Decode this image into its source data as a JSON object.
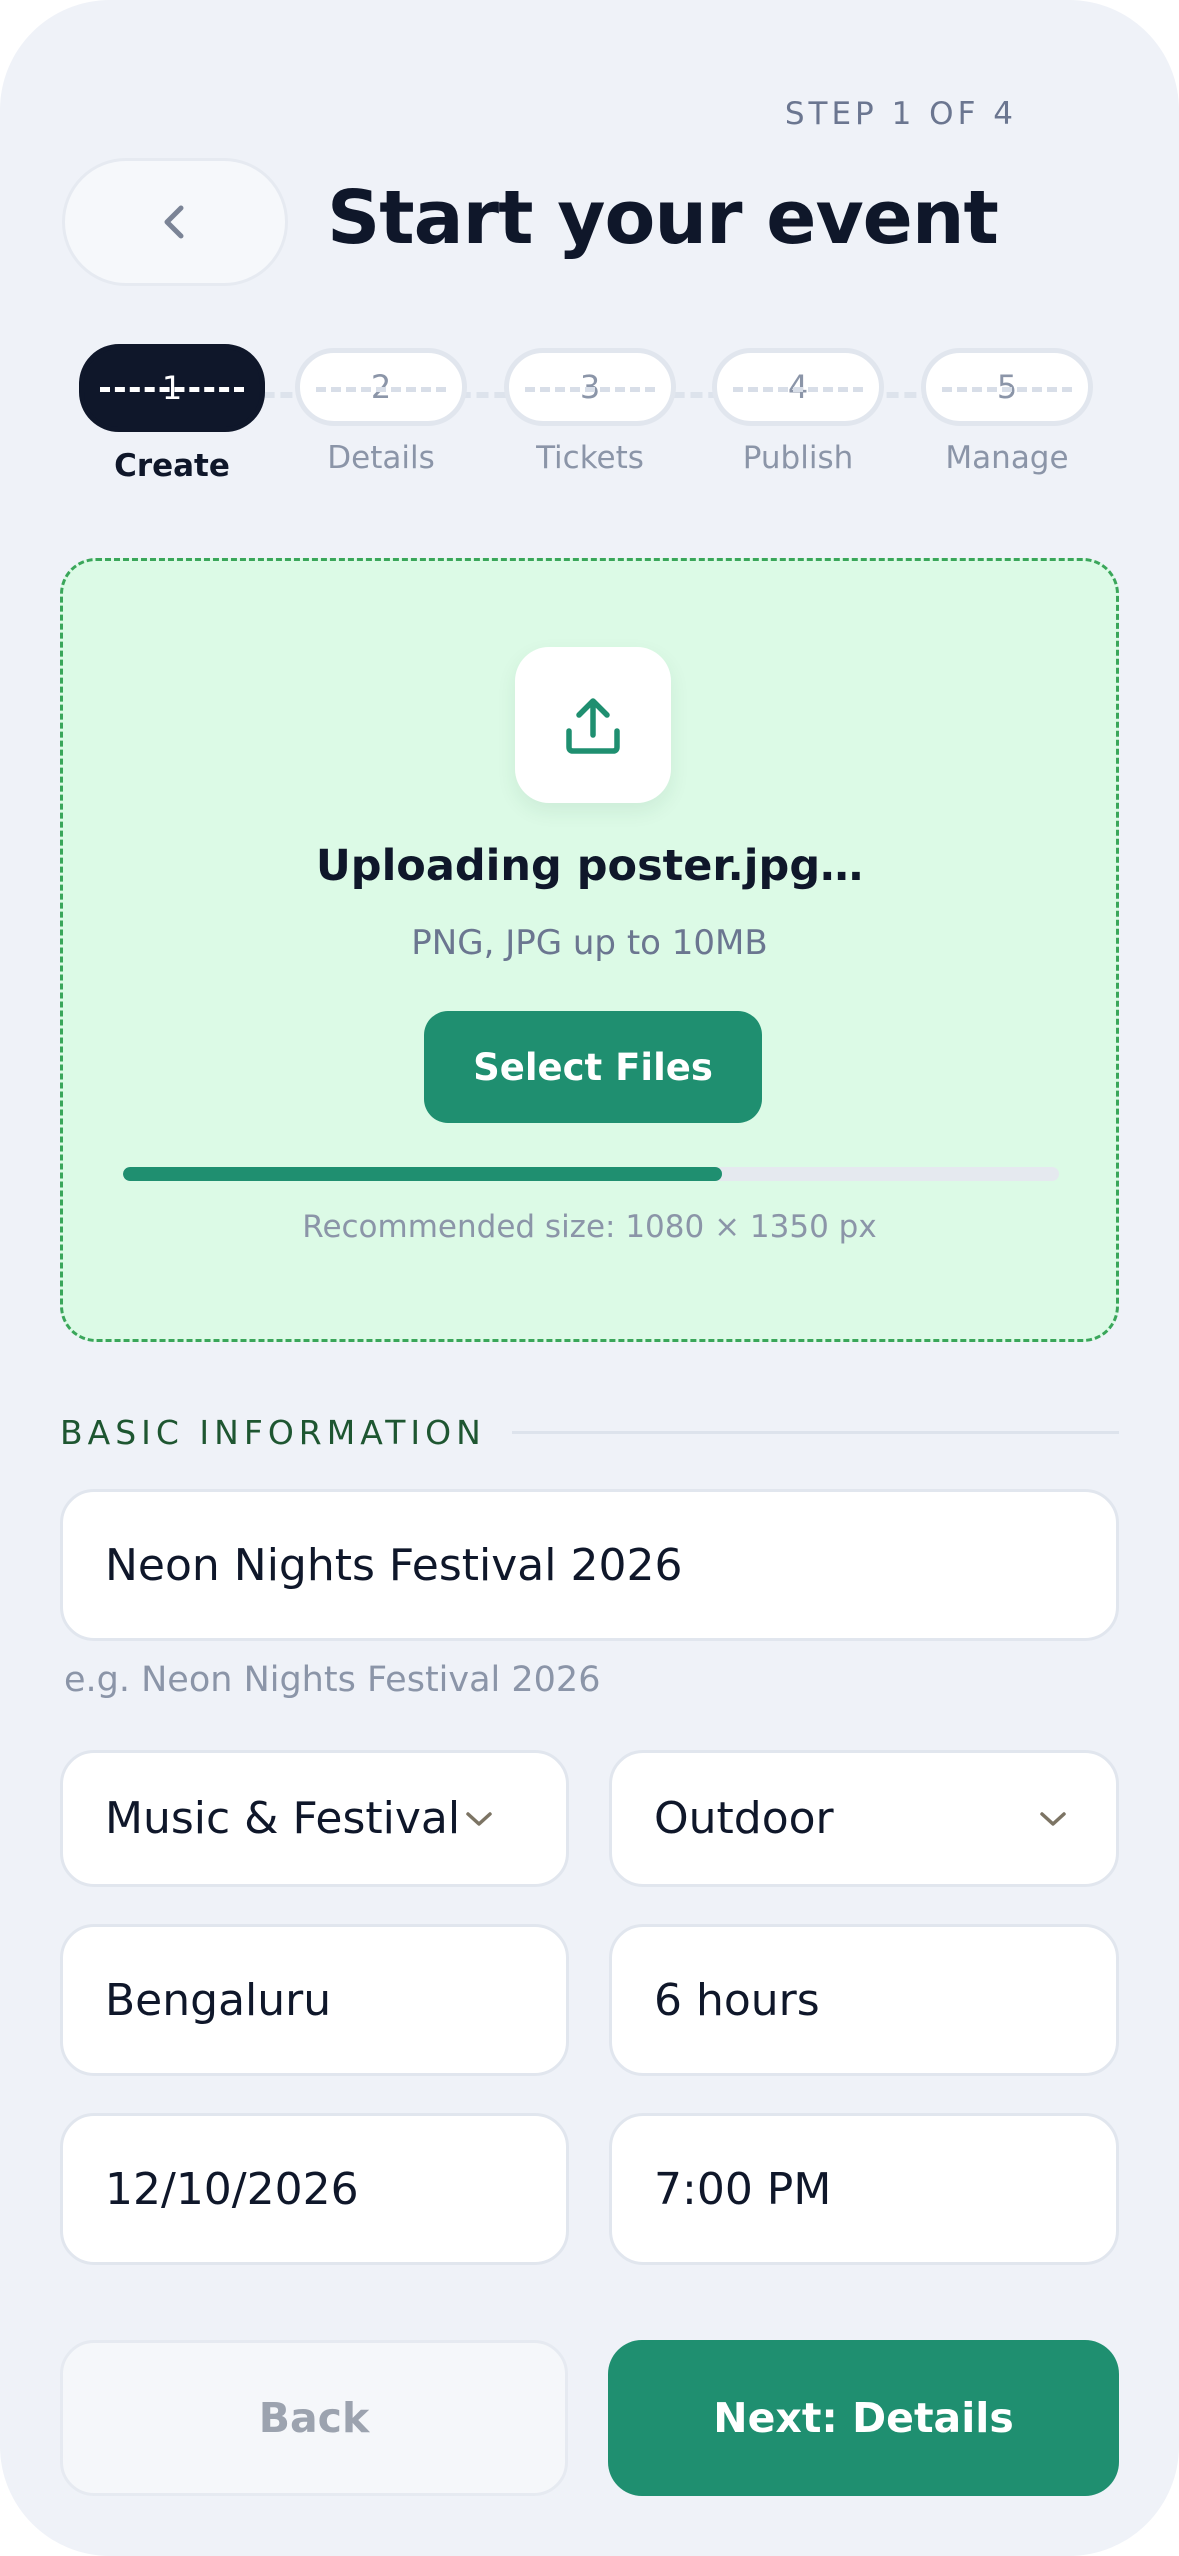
{
  "header": {
    "step_indicator": "STEP 1 OF 4",
    "title": "Start your event",
    "back_icon": "chevron-left-icon"
  },
  "stepper": {
    "current_step": 1,
    "steps": [
      {
        "number": "1",
        "label": "Create"
      },
      {
        "number": "2",
        "label": "Details"
      },
      {
        "number": "3",
        "label": "Tickets"
      },
      {
        "number": "4",
        "label": "Publish"
      },
      {
        "number": "5",
        "label": "Manage"
      }
    ]
  },
  "upload": {
    "icon": "upload-icon",
    "title": "Uploading poster.jpg…",
    "hint": "PNG, JPG up to 10MB",
    "select_label": "Select Files",
    "progress_fraction": 0.64,
    "recommendation": "Recommended size: 1080 × 1350 px",
    "accent_color": "#1f8f70"
  },
  "basic_info": {
    "section_label": "BASIC INFORMATION",
    "event_name": "Neon Nights Festival 2026",
    "event_name_helper": "e.g. Neon Nights Festival 2026",
    "category": "Music & Festival",
    "venue_type": "Outdoor",
    "city": "Bengaluru",
    "duration": "6 hours",
    "date": "12/10/2026",
    "time": "7:00 PM"
  },
  "footer": {
    "back_label": "Back",
    "next_label": "Next: Details"
  }
}
